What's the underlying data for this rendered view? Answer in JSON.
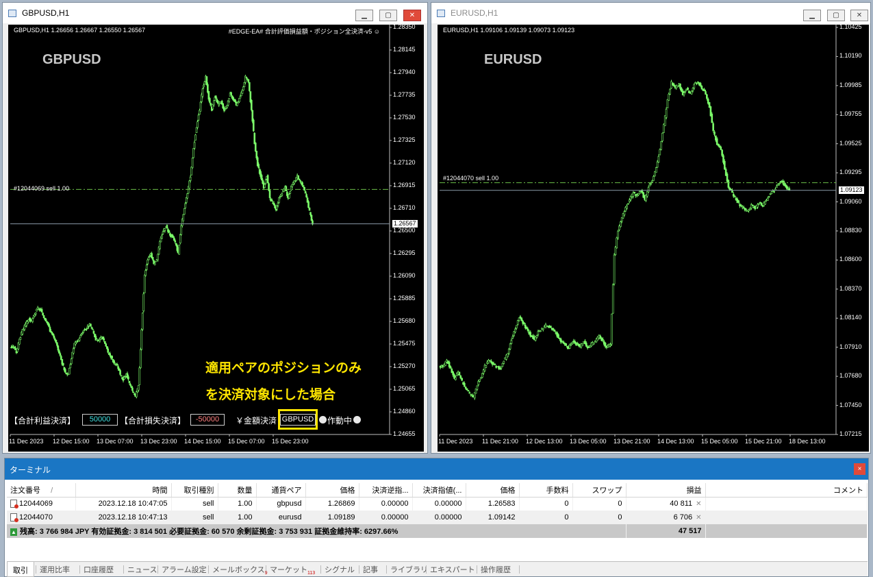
{
  "windows": [
    {
      "title": "GBPUSD,H1",
      "symbol_info": "GBPUSD,H1  1.26656 1.26667 1.26550 1.26567",
      "ea_label": "#EDGE-EA# 合計評価損益額・ポジション全決済-v5 ☺",
      "big_symbol": "GBPUSD",
      "order_label": "#12044069 sell 1.00",
      "current_price": "1.26567",
      "y_labels": [
        "1.28350",
        "1.28145",
        "1.27940",
        "1.27735",
        "1.27530",
        "1.27325",
        "1.27120",
        "1.26915",
        "1.26710",
        "1.26500",
        "1.26295",
        "1.26090",
        "1.25885",
        "1.25680",
        "1.25475",
        "1.25270",
        "1.25065",
        "1.24860",
        "1.24655"
      ],
      "x_labels": [
        "11 Dec 2023",
        "12 Dec 15:00",
        "13 Dec 07:00",
        "13 Dec 23:00",
        "14 Dec 15:00",
        "15 Dec 07:00",
        "15 Dec 23:00"
      ],
      "ylim": [
        1.24655,
        1.2835
      ],
      "order_price": 1.2688,
      "series": [
        1.2545,
        1.254,
        1.2552,
        1.256,
        1.2565,
        1.257,
        1.2568,
        1.2575,
        1.258,
        1.2578,
        1.2572,
        1.2568,
        1.256,
        1.2555,
        1.2548,
        1.254,
        1.253,
        1.2522,
        1.252,
        1.2535,
        1.2548,
        1.255,
        1.2555,
        1.256,
        1.2562,
        1.2565,
        1.256,
        1.2552,
        1.255,
        1.2555,
        1.2548,
        1.254,
        1.2536,
        1.253,
        1.2528,
        1.252,
        1.2515,
        1.252,
        1.2512,
        1.2505,
        1.25,
        1.251,
        1.256,
        1.261,
        1.2625,
        1.263,
        1.262,
        1.2625,
        1.264,
        1.265,
        1.2655,
        1.2648,
        1.2645,
        1.264,
        1.263,
        1.2655,
        1.267,
        1.2685,
        1.27,
        1.2725,
        1.2745,
        1.276,
        1.278,
        1.279,
        1.277,
        1.276,
        1.2772,
        1.2765,
        1.2768,
        1.276,
        1.2765,
        1.2775,
        1.277,
        1.2765,
        1.277,
        1.2778,
        1.279,
        1.2785,
        1.276,
        1.273,
        1.271,
        1.27,
        1.269,
        1.27,
        1.268,
        1.2675,
        1.267,
        1.268,
        1.2685,
        1.269,
        1.268,
        1.269,
        1.2695,
        1.27,
        1.2695,
        1.269,
        1.268,
        1.2668,
        1.2657
      ],
      "controls": {
        "profit_label": "【合計利益決済】",
        "profit_value": "50000",
        "loss_label": "【合計損失決済】",
        "loss_value": "-50000",
        "amount_label": "￥金額決済",
        "pair_value": "GBPUSD",
        "status_label": "作動中"
      },
      "annotation_line1": "適用ペアのポジションのみ",
      "annotation_line2": "を決済対象にした場合"
    },
    {
      "title": "EURUSD,H1",
      "symbol_info": "EURUSD,H1  1.09106 1.09139 1.09073 1.09123",
      "big_symbol": "EURUSD",
      "order_label": "#12044070 sell 1.00",
      "current_price": "1.09123",
      "y_labels": [
        "1.10425",
        "1.10190",
        "1.09985",
        "1.09755",
        "1.09525",
        "1.09295",
        "1.09060",
        "1.08830",
        "1.08600",
        "1.08370",
        "1.08140",
        "1.07910",
        "1.07680",
        "1.07450",
        "1.07215"
      ],
      "x_labels": [
        "11 Dec 2023",
        "11 Dec 21:00",
        "12 Dec 13:00",
        "13 Dec 05:00",
        "13 Dec 21:00",
        "14 Dec 13:00",
        "15 Dec 05:00",
        "15 Dec 21:00",
        "18 Dec 13:00"
      ],
      "ylim": [
        1.0715,
        1.1044
      ],
      "order_price": 1.09185,
      "series": [
        1.077,
        1.0775,
        1.0768,
        1.076,
        1.0765,
        1.0758,
        1.0752,
        1.0748,
        1.0745,
        1.0755,
        1.0762,
        1.077,
        1.0775,
        1.0772,
        1.077,
        1.0768,
        1.0775,
        1.078,
        1.0792,
        1.08,
        1.081,
        1.0805,
        1.08,
        1.0795,
        1.0792,
        1.0798,
        1.08,
        1.0803,
        1.0802,
        1.08,
        1.0795,
        1.079,
        1.0788,
        1.0785,
        1.079,
        1.0788,
        1.0786,
        1.079,
        1.0785,
        1.0788,
        1.079,
        1.0795,
        1.079,
        1.0785,
        1.0788,
        1.086,
        1.088,
        1.089,
        1.0898,
        1.0905,
        1.091,
        1.0908,
        1.0912,
        1.0905,
        1.0915,
        1.092,
        1.093,
        1.0945,
        1.0965,
        1.0985,
        1.1,
        1.0995,
        1.0998,
        1.099,
        1.0995,
        1.099,
        1.0998,
        1.1,
        1.0995,
        1.099,
        1.098,
        1.096,
        1.095,
        1.0945,
        1.093,
        1.0915,
        1.091,
        1.0905,
        1.09,
        1.0898,
        1.0895,
        1.09,
        1.0898,
        1.0902,
        1.09,
        1.0905,
        1.091,
        1.0912,
        1.0918,
        1.092,
        1.0915,
        1.0912
      ]
    }
  ],
  "terminal": {
    "title": "ターミナル",
    "close": "×",
    "columns": [
      "注文番号",
      "時間",
      "取引種別",
      "数量",
      "通貨ペア",
      "価格",
      "決済逆指...",
      "決済指値(...",
      "価格",
      "手数料",
      "スワップ",
      "損益",
      "コメント"
    ],
    "rows": [
      [
        "12044069",
        "2023.12.18 10:47:05",
        "sell",
        "1.00",
        "gbpusd",
        "1.26869",
        "0.00000",
        "0.00000",
        "1.26583",
        "0",
        "0",
        "40 811"
      ],
      [
        "12044070",
        "2023.12.18 10:47:13",
        "sell",
        "1.00",
        "eurusd",
        "1.09189",
        "0.00000",
        "0.00000",
        "1.09142",
        "0",
        "0",
        "6 706"
      ]
    ],
    "summary": "残高: 3 766 984 JPY  有効証拠金: 3 814 501  必要証拠金: 60 570  余剰証拠金: 3 753 931  証拠金維持率: 6297.66%",
    "summary_pl": "47 517",
    "sort_mark": "/",
    "tabs": [
      {
        "label": "取引"
      },
      {
        "label": "運用比率"
      },
      {
        "label": "口座履歴"
      },
      {
        "label": "ニュース"
      },
      {
        "label": "アラーム設定"
      },
      {
        "label": "メールボックス",
        "badge": "9"
      },
      {
        "label": "マーケット",
        "badge": "113"
      },
      {
        "label": "シグナル"
      },
      {
        "label": "記事"
      },
      {
        "label": "ライブラリ"
      },
      {
        "label": "エキスパート"
      },
      {
        "label": "操作履歴"
      }
    ]
  },
  "colors": {
    "candle": "#7CFC6A",
    "order_line": "#6cc04a",
    "price_line": "#8a9aa8",
    "highlight_box": "#ffe600",
    "profit_box": "#40e0e0",
    "loss_box": "#ff8080"
  }
}
